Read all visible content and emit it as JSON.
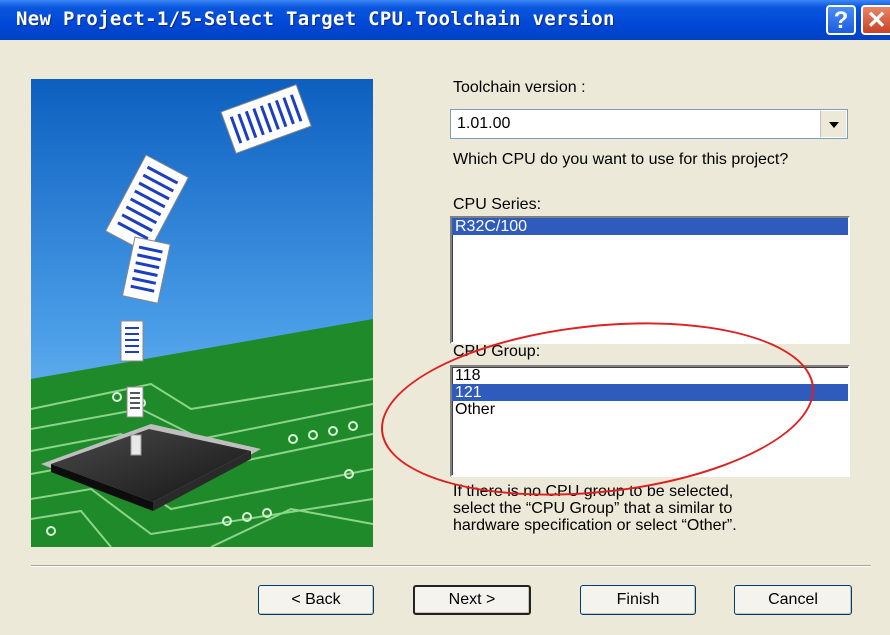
{
  "window": {
    "title": "New Project-1/5-Select Target CPU.Toolchain version",
    "help_icon_glyph": "?",
    "close_icon_glyph": "✕"
  },
  "form": {
    "toolchain_label": "Toolchain version :",
    "toolchain_value": "1.01.00",
    "question": "Which CPU do you want to use for this project?",
    "cpu_series_label": "CPU Series:",
    "cpu_series_items": [
      "R32C/100"
    ],
    "cpu_group_label": "CPU Group:",
    "cpu_group_items": [
      "118",
      "121",
      "Other"
    ],
    "hint_line1": "If there is no CPU group to be selected,",
    "hint_line2": "select the “CPU Group” that a similar to",
    "hint_line3": "hardware specification or select “Other”."
  },
  "buttons": {
    "back": "< Back",
    "next": "Next >",
    "finish": "Finish",
    "cancel": "Cancel"
  },
  "colors": {
    "title_bar": "#0048d6",
    "selection": "#2f5bbd",
    "annotation": "#e02020",
    "pcb_green": "#1f8a2a"
  }
}
